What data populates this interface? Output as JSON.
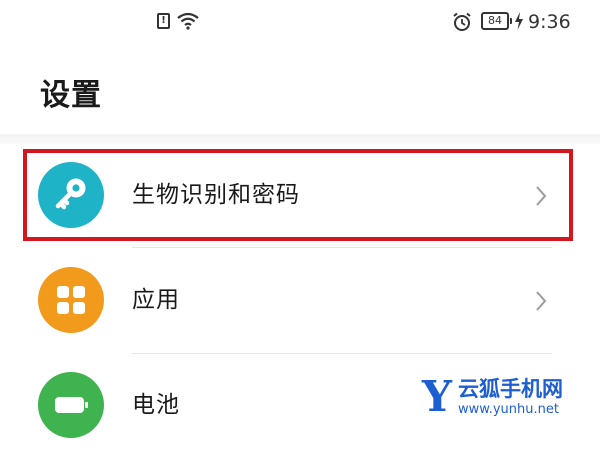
{
  "status_bar": {
    "notification_icon": "alert-icon",
    "wifi_icon": "wifi-icon",
    "alarm_icon": "alarm-icon",
    "battery_level": "84",
    "charging_icon": "charging-icon",
    "time": "9:36"
  },
  "header": {
    "title": "设置"
  },
  "settings": {
    "items": [
      {
        "label": "生物识别和密码",
        "icon": "key-icon",
        "icon_color": "#1fb3c8",
        "highlighted": true
      },
      {
        "label": "应用",
        "icon": "apps-grid-icon",
        "icon_color": "#f29a1c",
        "highlighted": false
      },
      {
        "label": "电池",
        "icon": "battery-icon",
        "icon_color": "#3fb34f",
        "highlighted": false
      }
    ]
  },
  "colors": {
    "highlight_border": "#d4171f",
    "watermark": "#1d5fd1"
  },
  "watermark": {
    "logo_letter": "Y",
    "name": "云狐手机网",
    "url": "www.yunhu.net"
  }
}
